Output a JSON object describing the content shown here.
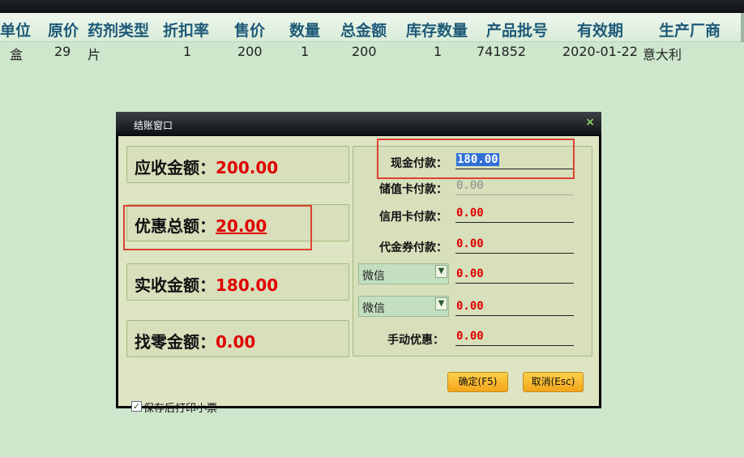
{
  "table": {
    "headers": [
      "单位",
      "原价",
      "药剂类型",
      "折扣率",
      "售价",
      "数量",
      "总金额",
      "库存数量",
      "产品批号",
      "有效期",
      "生产厂商"
    ],
    "row": [
      "盒",
      "29",
      "片",
      "1",
      "200",
      "1",
      "200",
      "1",
      "741852",
      "2020-01-22",
      "意大利"
    ]
  },
  "dialog": {
    "title": "结账窗口",
    "close": "×",
    "summary": [
      {
        "label": "应收金额：",
        "value": "200.00"
      },
      {
        "label": "优惠总额：",
        "value": "20.00"
      },
      {
        "label": "实收金额：",
        "value": "180.00"
      },
      {
        "label": "找零金额：",
        "value": "0.00"
      }
    ],
    "payments": {
      "cash": {
        "label": "现金付款：",
        "value": "180.00"
      },
      "stored_card": {
        "label": "储值卡付款：",
        "value": "0.00"
      },
      "credit_card": {
        "label": "信用卡付款：",
        "value": "0.00"
      },
      "voucher": {
        "label": "代金券付款：",
        "value": "0.00"
      },
      "combo1": {
        "selected": "微信",
        "value": "0.00"
      },
      "combo2": {
        "selected": "微信",
        "value": "0.00"
      },
      "manual_discount": {
        "label": "手动优惠：",
        "value": "0.00"
      }
    },
    "print_receipt": {
      "label": "保存后打印小票",
      "checked": true,
      "check_mark": "✓"
    },
    "confirm_label": "确定(F5)",
    "cancel_label": "取消(Esc)",
    "dropdown_arrow": "▼"
  },
  "colors": {
    "background": "#cde6cc",
    "amount_red": "#e00000",
    "header_text": "#1e5a78",
    "highlight_box": "#e0402f",
    "button": "#f3a51a"
  }
}
